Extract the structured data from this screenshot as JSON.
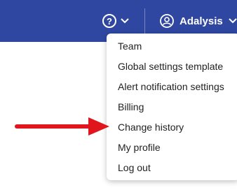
{
  "header": {
    "help_icon": "?",
    "user_name": "Adalysis",
    "brand_color": "#2f47a1"
  },
  "menu": {
    "items": [
      {
        "label": "Team"
      },
      {
        "label": "Global settings template"
      },
      {
        "label": "Alert notification settings"
      },
      {
        "label": "Billing"
      },
      {
        "label": "Change history"
      },
      {
        "label": "My profile"
      },
      {
        "label": "Log out"
      }
    ]
  },
  "annotation": {
    "arrow_color": "#e0161c",
    "arrow_target": "Change history"
  }
}
